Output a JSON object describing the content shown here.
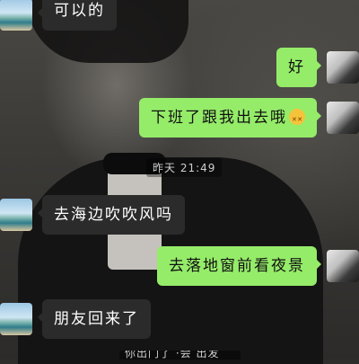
{
  "chat": {
    "messages": [
      {
        "side": "in",
        "text": "可以的"
      },
      {
        "side": "out",
        "text": "好"
      },
      {
        "side": "out",
        "text": "下班了跟我出去哦",
        "emoji": "dizzy-face-emoji"
      },
      {
        "side": "in",
        "text": "去海边吹吹风吗"
      },
      {
        "side": "out",
        "text": "去落地窗前看夜景"
      },
      {
        "side": "in",
        "text": "朋友回来了"
      }
    ],
    "timestamp": "昨天 21:49",
    "clipped_bottom_text": "你出门了 ·会 出发"
  },
  "colors": {
    "outgoing_bubble": "#95ec69",
    "incoming_bubble": "#2b2b2b"
  }
}
